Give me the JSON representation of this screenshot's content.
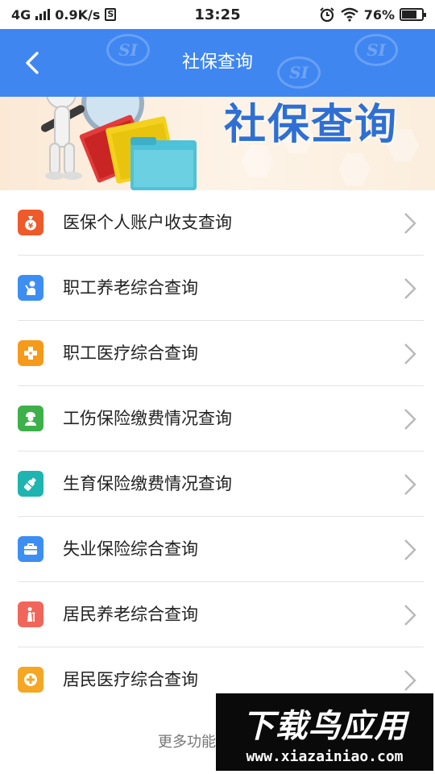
{
  "status_bar": {
    "network": "4G",
    "speed": "0.9K/s",
    "sim_badge": "S",
    "time": "13:25",
    "battery_percent": "76%",
    "battery_level": 0.76,
    "icons": [
      "signal-icon",
      "alarm-icon",
      "wifi-icon",
      "battery-icon"
    ]
  },
  "header": {
    "title": "社保查询",
    "back_icon": "back-arrow-icon",
    "watermark_text": "SI",
    "color": "#3f86f1"
  },
  "banner": {
    "title": "社保查询",
    "illustration": "magnifier-folders-illustration"
  },
  "menu": [
    {
      "label": "医保个人账户收支查询",
      "icon": "money-bag-icon",
      "color": "#ef5a2a"
    },
    {
      "label": "职工养老综合查询",
      "icon": "elder-person-icon",
      "color": "#3d8ef2"
    },
    {
      "label": "职工医疗综合查询",
      "icon": "medical-cross-icon",
      "color": "#f59a1b"
    },
    {
      "label": "工伤保险缴费情况查询",
      "icon": "worker-helmet-icon",
      "color": "#3db04a"
    },
    {
      "label": "生育保险缴费情况查询",
      "icon": "baby-bottle-icon",
      "color": "#1fb4b0"
    },
    {
      "label": "失业保险综合查询",
      "icon": "briefcase-icon",
      "color": "#3d8ef2"
    },
    {
      "label": "居民养老综合查询",
      "icon": "cane-elder-icon",
      "color": "#f0665a"
    },
    {
      "label": "居民医疗综合查询",
      "icon": "plus-circle-icon",
      "color": "#f5a623"
    }
  ],
  "footer": {
    "more_text": "更多功能"
  },
  "site_watermark": {
    "title": "下载鸟应用",
    "url": "www.xiazainiao.com"
  }
}
